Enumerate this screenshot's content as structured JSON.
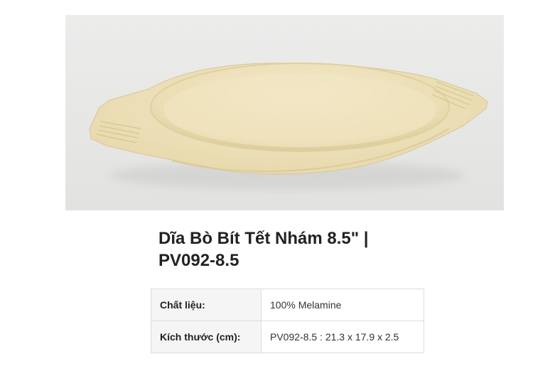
{
  "product": {
    "title_line1": "Dĩa Bò Bít Tết Nhám 8.5\" |",
    "title_line2": "PV092-8.5",
    "image_subject": "beige-melamine-steak-plate"
  },
  "specs": [
    {
      "label": "Chất liệu:",
      "value": "100% Melamine"
    },
    {
      "label": "Kích thước (cm):",
      "value": "PV092-8.5 : 21.3 x 17.9 x 2.5"
    }
  ],
  "colors": {
    "plate": "#efe3bd",
    "background": "#e8e8e7",
    "table_label_bg": "#f5f5f5",
    "table_border": "#dddddd"
  }
}
